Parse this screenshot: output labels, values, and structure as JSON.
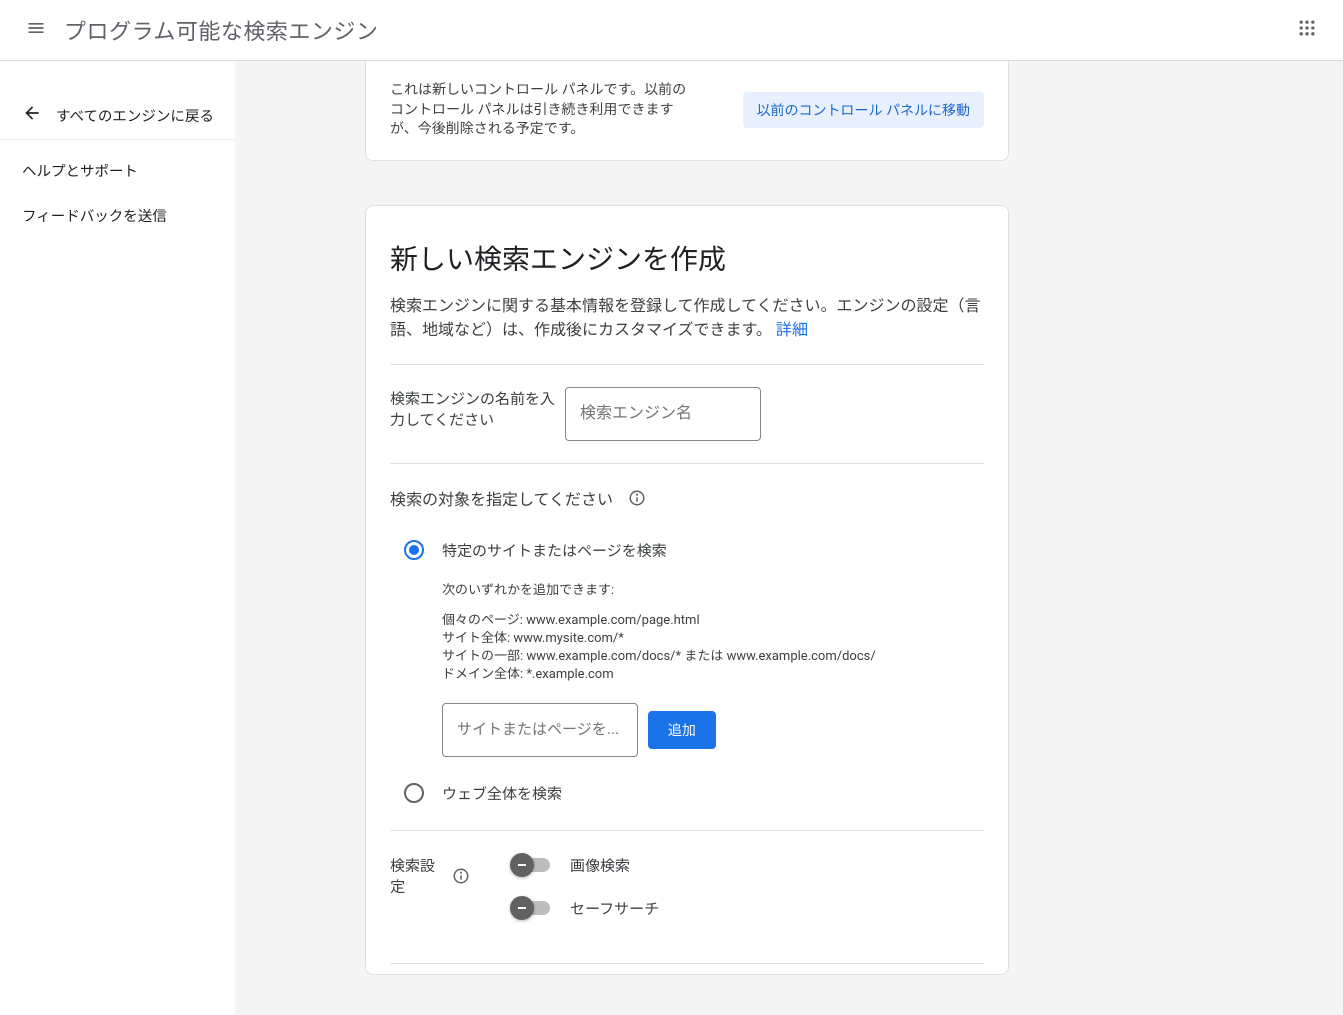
{
  "header": {
    "title": "プログラム可能な検索エンジン"
  },
  "sidebar": {
    "back_label": "すべてのエンジンに戻る",
    "help_label": "ヘルプとサポート",
    "feedback_label": "フィードバックを送信"
  },
  "banner": {
    "text": "これは新しいコントロール パネルです。以前のコントロール パネルは引き続き利用できますが、今後削除される予定です。",
    "button": "以前のコントロール パネルに移動"
  },
  "card": {
    "title": "新しい検索エンジンを作成",
    "description_prefix": "検索エンジンに関する基本情報を登録して作成してください。エンジンの設定（言語、地域など）は、作成後にカスタマイズできます。",
    "description_link": "詳細",
    "name_label": "検索エンジンの名前を入力してください",
    "name_placeholder": "検索エンジン名",
    "target_label": "検索の対象を指定してください",
    "radio_specific": "特定のサイトまたはページを検索",
    "radio_web": "ウェブ全体を検索",
    "details_lead": "次のいずれかを追加できます:",
    "details_line1": "個々のページ: www.example.com/page.html",
    "details_line2": "サイト全体: www.mysite.com/*",
    "details_line3": "サイトの一部: www.example.com/docs/* または www.example.com/docs/",
    "details_line4": "ドメイン全体: *.example.com",
    "site_placeholder": "サイトまたはページを...",
    "add_button": "追加",
    "settings_label": "検索設定",
    "toggle_image": "画像検索",
    "toggle_safe": "セーフサーチ"
  }
}
